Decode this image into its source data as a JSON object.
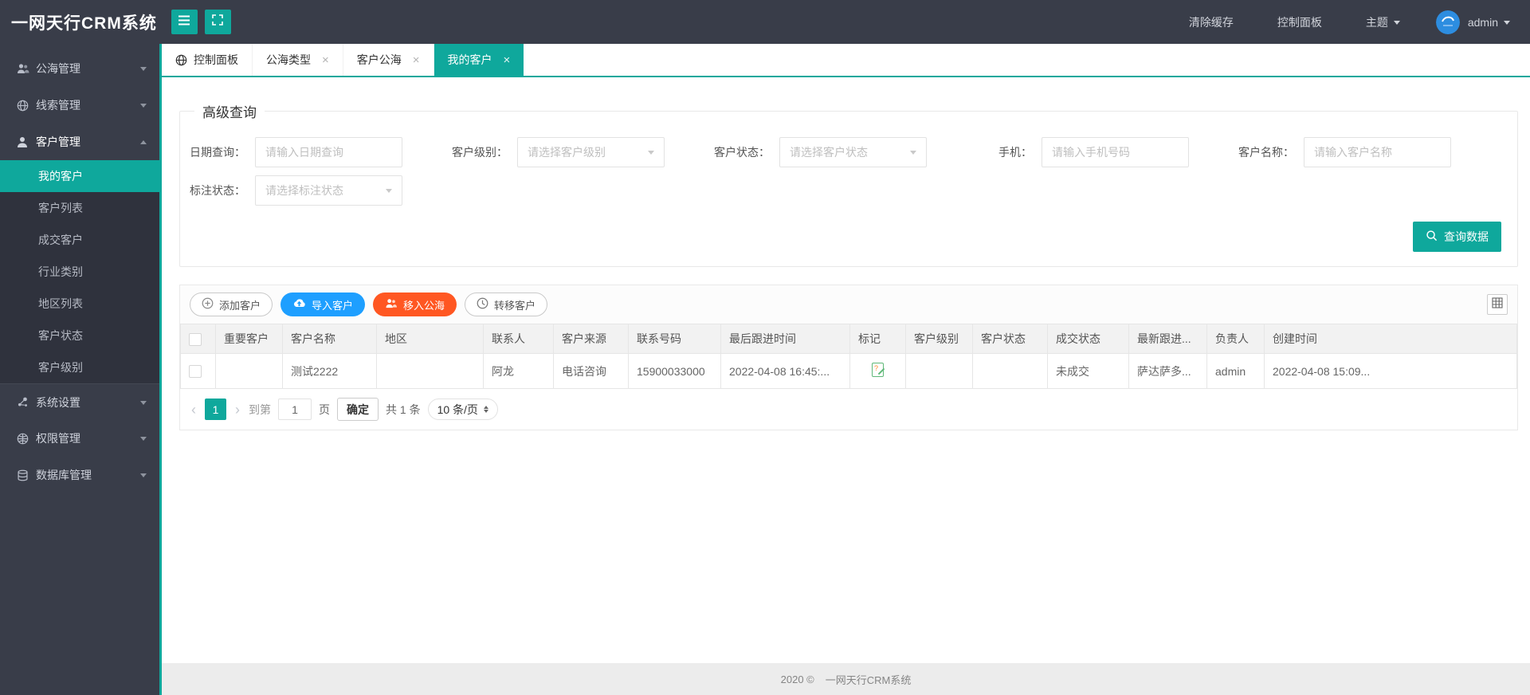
{
  "theme": {
    "teal": "#0FA89C",
    "blue": "#1E9FFF",
    "orange_red": "#FF5722",
    "header_bg": "#393D49",
    "submenu_bg": "#2F323D",
    "mark_green": "#5FB878",
    "avatar_blue": "#2D8DE0"
  },
  "header": {
    "logo": "一网天行CRM系统",
    "clear_cache": "清除缓存",
    "control_panel": "控制面板",
    "theme_label": "主题",
    "username": "admin",
    "icons": [
      "hamburger-icon",
      "fullscreen-icon",
      "avatar"
    ]
  },
  "tabs": [
    {
      "label": "控制面板",
      "icon": "globe-icon",
      "closable": false,
      "active": false
    },
    {
      "label": "公海类型",
      "closable": true,
      "active": false
    },
    {
      "label": "客户公海",
      "closable": true,
      "active": false
    },
    {
      "label": "我的客户",
      "closable": true,
      "active": true
    }
  ],
  "close_glyph": "×",
  "sidebar": {
    "items": [
      {
        "label": "公海管理",
        "icon": "users-icon",
        "expanded": false
      },
      {
        "label": "线索管理",
        "icon": "globe-icon",
        "expanded": false
      },
      {
        "label": "客户管理",
        "icon": "user-icon",
        "expanded": true,
        "children": [
          {
            "label": "我的客户",
            "active": true
          },
          {
            "label": "客户列表",
            "active": false
          },
          {
            "label": "成交客户",
            "active": false
          },
          {
            "label": "行业类别",
            "active": false
          },
          {
            "label": "地区列表",
            "active": false
          },
          {
            "label": "客户状态",
            "active": false
          },
          {
            "label": "客户级别",
            "active": false
          }
        ]
      },
      {
        "label": "系统设置",
        "icon": "nodes-icon",
        "expanded": false
      },
      {
        "label": "权限管理",
        "icon": "globe-grid-icon",
        "expanded": false
      },
      {
        "label": "数据库管理",
        "icon": "database-icon",
        "expanded": false
      }
    ]
  },
  "query": {
    "legend": "高级查询",
    "fields": [
      {
        "label": "日期查询：",
        "placeholder": "请输入日期查询",
        "type": "input"
      },
      {
        "label": "客户级别：",
        "placeholder": "请选择客户级别",
        "type": "select"
      },
      {
        "label": "客户状态：",
        "placeholder": "请选择客户状态",
        "type": "select"
      },
      {
        "label": "手机：",
        "placeholder": "请输入手机号码",
        "type": "input"
      },
      {
        "label": "客户名称：",
        "placeholder": "请输入客户名称",
        "type": "input"
      },
      {
        "label": "标注状态：",
        "placeholder": "请选择标注状态",
        "type": "select"
      }
    ],
    "submit_label": "查询数据",
    "submit_icon": "search-icon"
  },
  "toolbar": {
    "add": "添加客户",
    "import": "导入客户",
    "move_to_sea": "移入公海",
    "transfer": "转移客户",
    "icons": [
      "plus-circle-icon",
      "cloud-upload-icon",
      "people-icon",
      "clock-icon",
      "grid-icon"
    ]
  },
  "table": {
    "columns": [
      "重要客户",
      "客户名称",
      "地区",
      "联系人",
      "客户来源",
      "联系号码",
      "最后跟进时间",
      "标记",
      "客户级别",
      "客户状态",
      "成交状态",
      "最新跟进...",
      "负责人",
      "创建时间"
    ],
    "rows": [
      {
        "important": "",
        "name": "测试2222",
        "region": "",
        "contact": "阿龙",
        "source": "电话咨询",
        "phone": "15900033000",
        "last_follow": "2022-04-08 16:45:...",
        "mark": "mark-icon",
        "level": "",
        "status": "",
        "deal_status": "未成交",
        "latest_follow": "萨达萨多...",
        "owner": "admin",
        "created": "2022-04-08 15:09..."
      }
    ]
  },
  "pagination": {
    "prev": "‹",
    "next": "›",
    "current": "1",
    "goto_label": "到第",
    "page_value": "1",
    "page_unit": "页",
    "confirm_label": "确定",
    "total_label": "共 1 条",
    "size_label": "10 条/页"
  },
  "footer": {
    "copyright": "2020 ©",
    "brand": "一网天行CRM系统"
  }
}
